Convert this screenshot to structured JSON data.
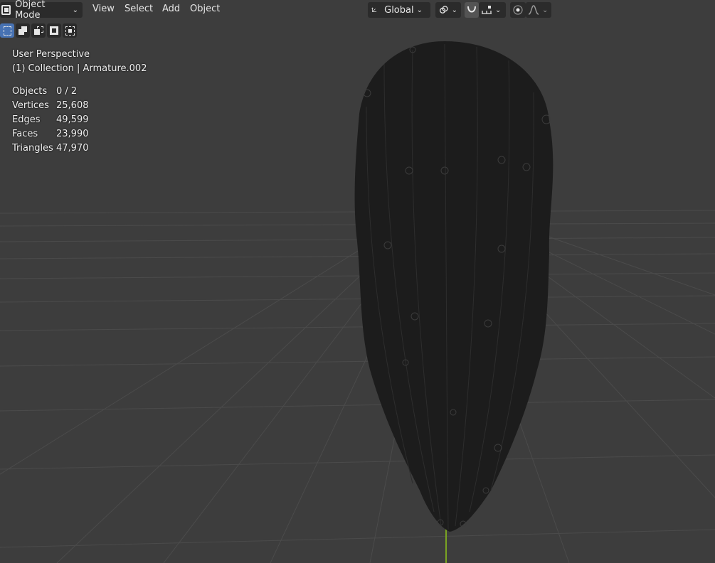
{
  "header": {
    "mode_label": "Object Mode",
    "menus": [
      "View",
      "Select",
      "Add",
      "Object"
    ],
    "orientation_label": "Global"
  },
  "overlay": {
    "view_name": "User Perspective",
    "collection_info": "(1) Collection | Armature.002"
  },
  "stats": [
    {
      "label": "Objects",
      "value": "0 / 2"
    },
    {
      "label": "Vertices",
      "value": "25,608"
    },
    {
      "label": "Edges",
      "value": "49,599"
    },
    {
      "label": "Faces",
      "value": "23,990"
    },
    {
      "label": "Triangles",
      "value": "47,970"
    }
  ],
  "icons": {
    "mode": "object-mode-icon",
    "orientation": "transform-orientation-icon",
    "pivot": "link-icon",
    "snap": "magnet-snap-icon",
    "snap_target": "snap-increment-icon",
    "proportional": "proportional-editing-icon",
    "falloff": "falloff-curve-icon"
  },
  "colors": {
    "viewport_bg": "#3d3d3d",
    "grid_line": "#4a4a4a",
    "header_button": "#2b2b2b",
    "active_select": "#4772b3",
    "mesh": "#1c1c1c",
    "z_axis": "#7aa322"
  }
}
